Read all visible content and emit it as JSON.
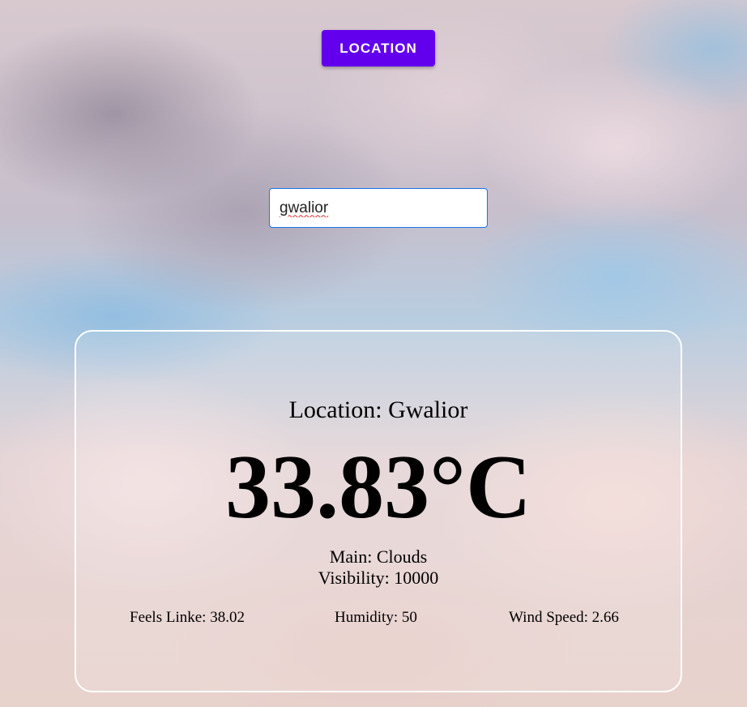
{
  "header": {
    "location_button_label": "LOCATION"
  },
  "search": {
    "value": "gwalior"
  },
  "weather": {
    "location_label": "Location: Gwalior",
    "temperature": "33.83°C",
    "main": "Main: Clouds",
    "visibility": "Visibility: 10000",
    "feels_like": "Feels Linke: 38.02",
    "humidity": "Humidity: 50",
    "wind_speed": "Wind Speed: 2.66"
  },
  "colors": {
    "button": "#6200ee",
    "input_border": "#1a73e8",
    "card_border": "#ffffff"
  }
}
